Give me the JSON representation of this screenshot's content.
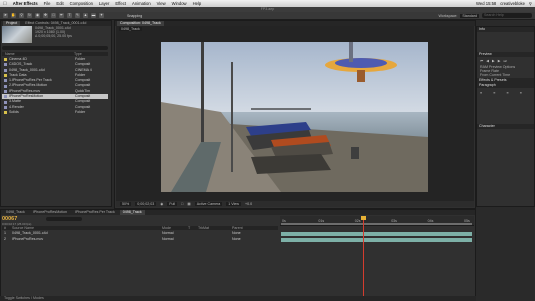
{
  "menubar": {
    "apple": "",
    "app": "After Effects",
    "items": [
      "File",
      "Edit",
      "Composition",
      "Layer",
      "Effect",
      "Animation",
      "View",
      "Window",
      "Help"
    ],
    "clock": "Wed 15:58",
    "user": "creativebloke"
  },
  "window": {
    "title": "FP3.aep"
  },
  "toolbar": {
    "snapping": "Snapping",
    "workspace_label": "Workspace:",
    "workspace_value": "Standard",
    "search_placeholder": "Search Help"
  },
  "project": {
    "tabs": [
      "Project",
      "Effect Controls: 0498_Track_0001.c4d"
    ],
    "info": [
      "0498_Track_0001.c4d",
      "1920 x 1080 (1.00)",
      "Δ 0;00;05;00, 25.00 fps"
    ],
    "columns": [
      "Name",
      "Type"
    ],
    "items": [
      {
        "name": "Cinema 4D",
        "type": "Folder",
        "color": "#d7c04a",
        "selected": false
      },
      {
        "name": "C4DOS_Track",
        "type": "Composit",
        "color": "#8e92b8",
        "selected": false
      },
      {
        "name": "0498_Track_0001.c4d",
        "type": "CINEMA 4",
        "color": "#8e92b8",
        "selected": false
      },
      {
        "name": "Track Data",
        "type": "Folder",
        "color": "#d7c04a",
        "selected": false
      },
      {
        "name": "1.IPhoneProRes Per Track",
        "type": "Composit",
        "color": "#8e92b8",
        "selected": false
      },
      {
        "name": "2.IPhoneProRes Motion",
        "type": "Composit",
        "color": "#8e92b8",
        "selected": false
      },
      {
        "name": "IPhoneProRes.mov",
        "type": "QuickTim",
        "color": "#8e92b8",
        "selected": false
      },
      {
        "name": "IPhoneProResMotion",
        "type": "Composit",
        "color": "#8e92b8",
        "selected": true
      },
      {
        "name": "3.Matte",
        "type": "Composit",
        "color": "#8e92b8",
        "selected": false
      },
      {
        "name": "4.Render",
        "type": "Composit",
        "color": "#8e92b8",
        "selected": false
      },
      {
        "name": "Solids",
        "type": "Folder",
        "color": "#d7c04a",
        "selected": false
      }
    ]
  },
  "viewer": {
    "tabs": [
      "Composition: 0498_Track"
    ],
    "breadcrumb": "0498_Track",
    "zoom": "50%",
    "timecode": "0;00;02;03",
    "resolution": "Full",
    "camera": "Active Camera",
    "views": "1 View",
    "exposure": "+0.0"
  },
  "right": {
    "info_title": "Info",
    "preview_title": "Preview",
    "effects_title": "Effects & Presets",
    "paragraph_title": "Paragraph",
    "character_title": "Character",
    "labels": [
      "RAM Preview Options",
      "Frame Rate",
      "Skip",
      "Resolution",
      "From Current Time",
      "Full Screen",
      "Auto",
      "Align",
      "Indent"
    ],
    "tracker_title": "Tracker",
    "tracker_labels": [
      "Track Camera",
      "Warp Stabilizer",
      "Track Motion",
      "Stabilize Motion",
      "Motion Source",
      "Current Track",
      "Track Type",
      "Position",
      "Rotation",
      "Scale",
      "Motion Target",
      "Edit Target",
      "Options",
      "Analyze",
      "Reset",
      "Apply"
    ]
  },
  "timeline": {
    "tabs": [
      "0498_Track",
      "IPhoneProResMotion",
      "IPhoneProRes Per Track",
      "0498_Track"
    ],
    "timecode": "00067",
    "timecode_sub": "0:00:02:17 (25.00 fps)",
    "columns": [
      "#",
      "Source Name",
      "Mode",
      "T",
      "TrkMat",
      "Parent"
    ],
    "layers": [
      {
        "num": "1",
        "name": "0498_Track_0001.c4d",
        "mode": "Normal",
        "parent": "None",
        "start": 0.0,
        "end": 1.0
      },
      {
        "num": "2",
        "name": "IPhoneProRes.mov",
        "mode": "Normal",
        "parent": "None",
        "start": 0.0,
        "end": 1.0
      }
    ],
    "ruler_ticks": [
      "0s",
      "01s",
      "02s",
      "03s",
      "04s",
      "05s"
    ],
    "current_time": 0.43,
    "footer": "Toggle Switches / Modes"
  }
}
